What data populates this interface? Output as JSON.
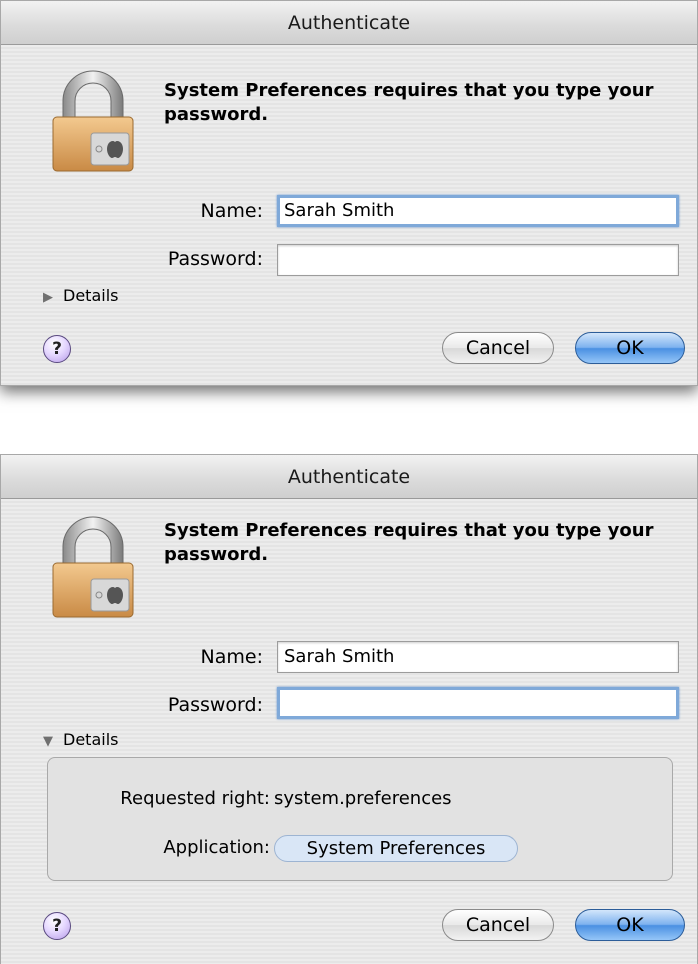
{
  "dialog_collapsed": {
    "title": "Authenticate",
    "message": "System Preferences requires that you type your password.",
    "name_label": "Name:",
    "name_value": "Sarah Smith",
    "password_label": "Password:",
    "password_value": "",
    "details_label": "Details",
    "details_expanded": false,
    "help_label": "?",
    "cancel_label": "Cancel",
    "ok_label": "OK"
  },
  "dialog_expanded": {
    "title": "Authenticate",
    "message": "System Preferences requires that you type your password.",
    "name_label": "Name:",
    "name_value": "Sarah Smith",
    "password_label": "Password:",
    "password_value": "",
    "details_label": "Details",
    "details_expanded": true,
    "requested_right_label": "Requested right:",
    "requested_right_value": "system.preferences",
    "application_label": "Application:",
    "application_value": "System Preferences",
    "help_label": "?",
    "cancel_label": "Cancel",
    "ok_label": "OK"
  },
  "icons": {
    "lock": "lock-icon",
    "disclosure_collapsed": "triangle-right-icon",
    "disclosure_expanded": "triangle-down-icon",
    "help": "help-icon"
  },
  "colors": {
    "ok_button": "#4a90e2",
    "focus_ring": "#7fa9d9",
    "help_button": "#b69ae8"
  }
}
